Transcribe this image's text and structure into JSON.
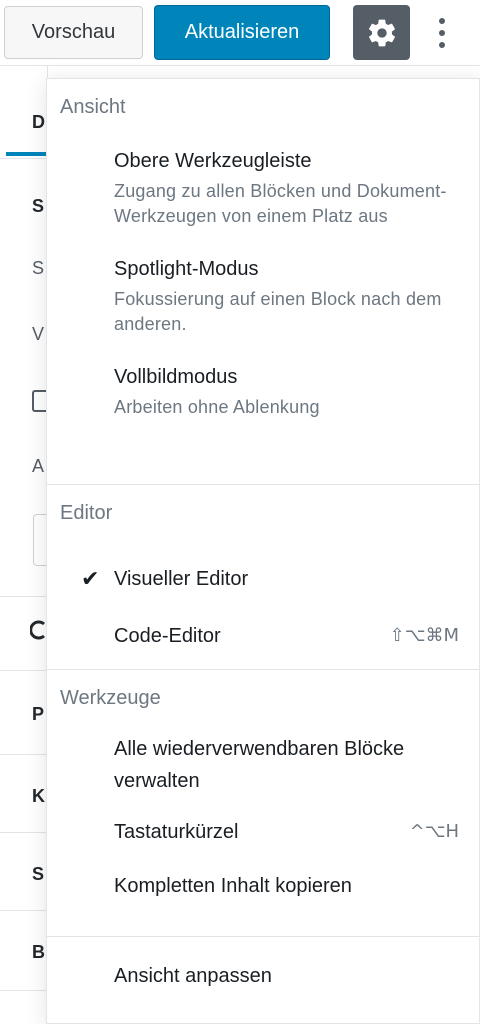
{
  "toolbar": {
    "preview_label": "Vorschau",
    "update_label": "Aktualisieren",
    "settings_icon": "gear-icon",
    "more_icon": "more-vertical-icon"
  },
  "sidebar": {
    "letters": [
      "D",
      "S",
      "S",
      "V",
      "A",
      "P",
      "K",
      "S",
      "B"
    ]
  },
  "menu": {
    "groups": [
      {
        "label": "Ansicht",
        "items": [
          {
            "title": "Obere Werkzeugleiste",
            "description": "Zugang zu allen Blöcken und Dokument-Werkzeugen von einem Platz aus"
          },
          {
            "title": "Spotlight-Modus",
            "description": "Fokussierung auf einen Block nach dem anderen."
          },
          {
            "title": "Vollbildmodus",
            "description": "Arbeiten ohne Ablenkung"
          }
        ]
      },
      {
        "label": "Editor",
        "items": [
          {
            "title": "Visueller Editor",
            "checked": "✔"
          },
          {
            "title": "Code-Editor",
            "shortcut": "⇧⌥⌘M"
          }
        ]
      },
      {
        "label": "Werkzeuge",
        "items": [
          {
            "title": "Alle wiederverwendbaren Blöcke verwalten"
          },
          {
            "title": "Tastaturkürzel",
            "shortcut": "^⌥H"
          },
          {
            "title": "Kompletten Inhalt kopieren"
          }
        ]
      },
      {
        "items": [
          {
            "title": "Ansicht anpassen"
          }
        ]
      }
    ]
  }
}
